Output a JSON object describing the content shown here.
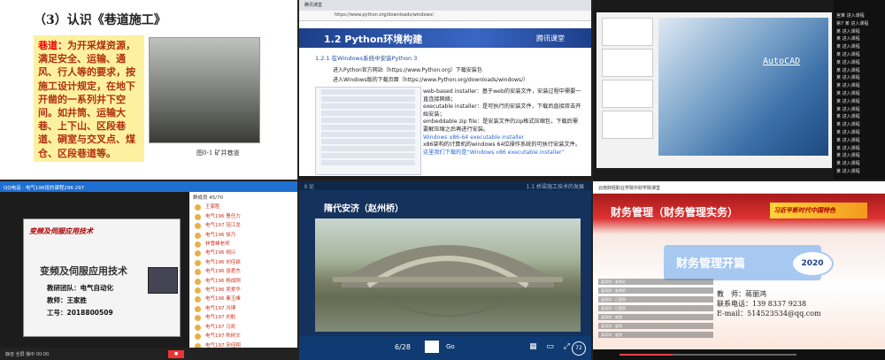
{
  "p1": {
    "title": "（3）认识《巷道施工》",
    "keyword": "巷道：",
    "text": "为开采煤资源，满足安全、运输、通风、行人等的要求，按施工设计规定，在地下开凿的一系列井下空间。如井筒、运输大巷、上下山、区段巷道、硐室与交叉点、煤仓、区段巷道等。",
    "caption": "图0-1 矿井巷道"
  },
  "p2": {
    "tab": "腾讯课堂",
    "url": "https://www.python.org/downloads/windows/",
    "header_title": "1.2 Python环境构建",
    "brand": "腾讯课堂",
    "sub": "1.2.1 在Windows系统中安装Python 3",
    "line1": "进入Python官方网站（https://www.Python.org）下载安装包",
    "line2": "进入Windows版的下载页面（https://www.Python.org/downloads/windows/）",
    "note1": "web-based installer：基于web的安装文件，安装过程中需要一直连接网络；",
    "note2": "executable installer：是可执行的安装文件，下载后直接双击开始安装；",
    "note3": "embeddable zip file：是安装文件的zip格式压缩包，下载后需要解压缩之后再进行安装。",
    "note4": "Windows x86-64 executable installer",
    "note5": "x86架构的计算机的windows 64位操作系统的可执行安装文件。",
    "note6": "这里我们下载的是“Windows x86 executable installer”"
  },
  "p3": {
    "watermark": "AutoCAD",
    "list": [
      "宫某 进入课程",
      "第7 某 进入课程",
      "某 进入课程",
      "某 进入课程",
      "某 进入课程",
      "某 进入课程",
      "某 进入课程",
      "某 进入课程",
      "某 进入课程",
      "某 进入课程",
      "某 进入课程",
      "某 进入课程",
      "某 进入课程",
      "某 进入课程",
      "某 进入课程",
      "某 进入课程",
      "某 进入课程",
      "某 进入课程",
      "某 进入课程",
      "某 进入课程",
      "某 进入课程"
    ]
  },
  "p4": {
    "app": "QQ电话 · 电气196班的课程296·297",
    "video_title": "变频及伺服应用技术",
    "big_title": "变频及伺服应用技术",
    "team": "教研团队：电气自动化",
    "teacher": "教师：王家胜",
    "id": "工号：2018800509",
    "members_header": "群成员 45/70",
    "members": [
      "王家胜",
      "电气196 曹任力",
      "电气197 冠江龙",
      "电气196 徐乃",
      "林雪峰老师",
      "电气196 胡兴",
      "电气196 刘佳颖",
      "电气196 张君杰",
      "电气196 杨成刚",
      "电气196 吴爱华",
      "电气196 秦玉峰",
      "电气197 冯博",
      "电气197 刘航",
      "电气197 马凯",
      "电气197 陈树文",
      "电气197 宋佳翔"
    ],
    "footer": "静音   全屏   播中   00:00"
  },
  "p5": {
    "top_left": "Ⅱ 论",
    "top_right": "1.1 桥梁施工技术的发展",
    "title": "隋代安济（赵州桥）",
    "page": "6/28",
    "go": "Go",
    "badge": "72"
  },
  "p6": {
    "bar": "云南财经职业学院中财学院课堂",
    "title": "财务管理（财务管理实务）",
    "banner": "习近平新时代中国特色",
    "main_title": "财务管理开篇",
    "year": "2020",
    "teacher": "教　师：蒋丽鸿",
    "phone": "联系电话：139 8337 9238",
    "email": "E-mail：514523534@qq.com",
    "chats": [
      "某同学：老师好",
      "某同学：老师好",
      "某同学：已签到",
      "某同学：已签到",
      "某同学：收到",
      "某同学：收到",
      "某同学：收到"
    ]
  }
}
